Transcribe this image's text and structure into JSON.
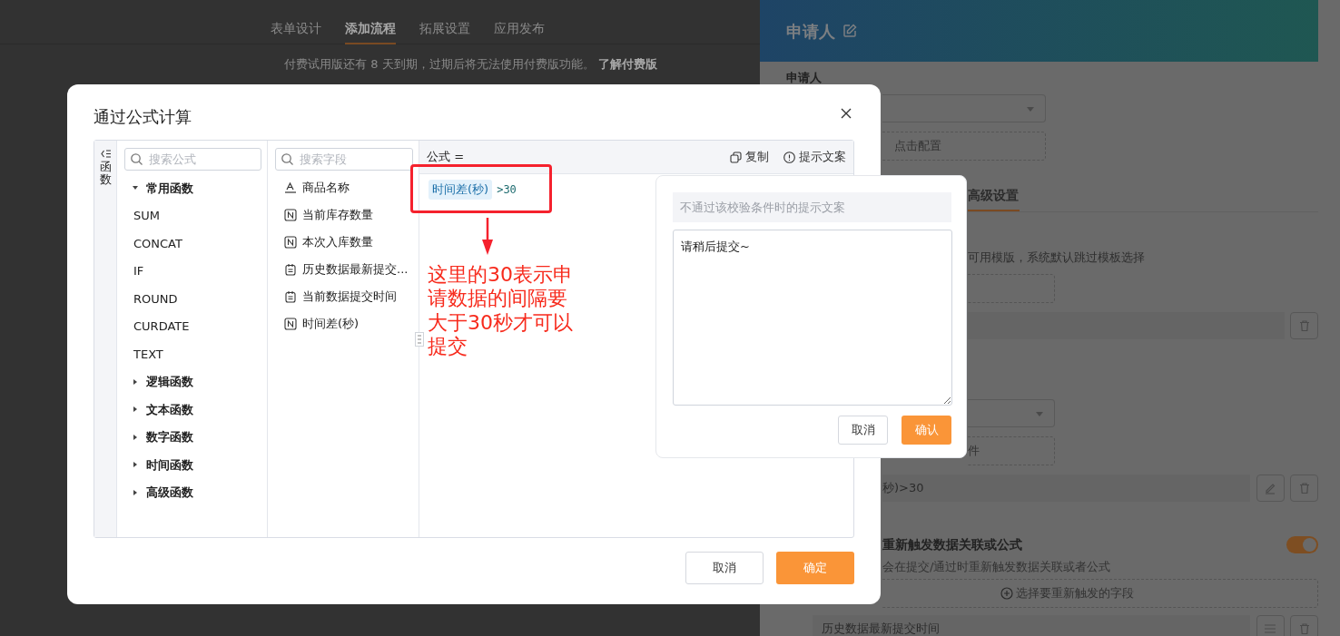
{
  "top_nav": {
    "tabs": [
      {
        "label": "表单设计",
        "selected": false
      },
      {
        "label": "添加流程",
        "selected": true
      },
      {
        "label": "拓展设置",
        "selected": false
      },
      {
        "label": "应用发布",
        "selected": false
      }
    ]
  },
  "notice": {
    "text": "付费试用版还有 8 天到期，过期后将无法使用付费版功能。",
    "link": "了解付费版"
  },
  "side_panel": {
    "title": "申请人",
    "field_label": "申请人",
    "config_button": "点击配置",
    "tab": "高级设置",
    "template_hint": "可用模版，系统默认跳过模板选择",
    "condition_button": "件",
    "rule": "秒)>30",
    "retrigger": {
      "title": "重新触发数据关联或公式",
      "on": true,
      "description": "会在提交/通过时重新触发数据关联或者公式",
      "add_button": "选择要重新触发的字段",
      "fields": [
        "历史数据最新提交时间"
      ]
    }
  },
  "dialog": {
    "title": "通过公式计算",
    "sidebar_tab": "函数",
    "functions": {
      "placeholder": "搜索公式",
      "groups": [
        {
          "label": "常用函数",
          "expanded": true,
          "children": [
            {
              "label": "SUM"
            },
            {
              "label": "CONCAT"
            },
            {
              "label": "IF"
            },
            {
              "label": "ROUND"
            },
            {
              "label": "CURDATE"
            },
            {
              "label": "TEXT"
            }
          ]
        },
        {
          "label": "逻辑函数",
          "expanded": false
        },
        {
          "label": "文本函数",
          "expanded": false
        },
        {
          "label": "数字函数",
          "expanded": false
        },
        {
          "label": "时间函数",
          "expanded": false
        },
        {
          "label": "高级函数",
          "expanded": false
        }
      ]
    },
    "fields": {
      "placeholder": "搜索字段",
      "items": [
        {
          "kind": "text",
          "label": "商品名称"
        },
        {
          "kind": "number",
          "label": "当前库存数量"
        },
        {
          "kind": "number",
          "label": "本次入库数量"
        },
        {
          "kind": "date",
          "label": "历史数据最新提交..."
        },
        {
          "kind": "date",
          "label": "当前数据提交时间"
        },
        {
          "kind": "number",
          "label": "时间差(秒)"
        }
      ]
    },
    "formula": {
      "label": "公式 =",
      "copy": "复制",
      "hint": "提示文案",
      "token": "时间差(秒)",
      "expression": ">30"
    },
    "buttons": [
      "取消",
      "确定"
    ]
  },
  "hint_popover": {
    "label": "不通过该校验条件时的提示文案",
    "value": "请稍后提交~",
    "buttons": [
      "取消",
      "确认"
    ]
  },
  "annotation": {
    "text": "这里的30表示申请数据的间隔要大于30秒才可以提交"
  }
}
